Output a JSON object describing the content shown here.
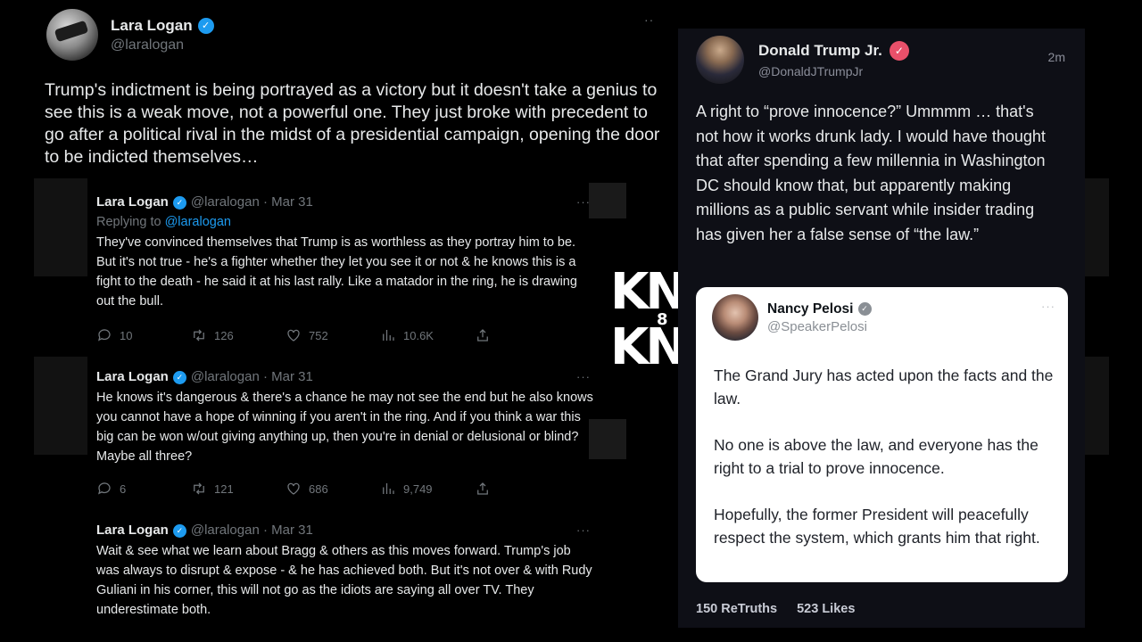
{
  "main_tweet": {
    "name": "Lara Logan",
    "handle": "@laralogan",
    "more": "··",
    "text": "Trump's indictment is being portrayed as a victory but it doesn't take a genius to see this is a weak move, not a powerful one. They just broke with precedent to go after a political rival in the midst of a presidential campaign, opening the door to be indicted themselves…"
  },
  "replies": [
    {
      "name": "Lara Logan",
      "meta": "@laralogan · Mar 31",
      "replying_prefix": "Replying to ",
      "replying_to": "@laralogan",
      "text": "They've convinced themselves that Trump is as worthless as they portray him to be. But it's not true - he's a fighter whether they let you see it or not & he knows this is a fight to the death - he said it at his last rally. Like a matador in the ring, he is drawing out the bull.",
      "replies_count": "10",
      "retweets": "126",
      "likes": "752",
      "views": "10.6K"
    },
    {
      "name": "Lara Logan",
      "meta": "@laralogan · Mar 31",
      "text": "He knows it's dangerous & there's a chance he may not see the end but he also knows you cannot have a hope of winning if you aren't in the ring. And if you think a war this big can be won w/out giving anything up, then you're in denial or delusional or blind? Maybe all three?",
      "replies_count": "6",
      "retweets": "121",
      "likes": "686",
      "views": "9,749"
    },
    {
      "name": "Lara Logan",
      "meta": "@laralogan · Mar 31",
      "text": "Wait & see what we learn about Bragg & others as this moves forward. Trump's job was always to disrupt & expose - & he has achieved both. But it's not over & with Rudy Guliani in his corner, this will not go as the idiots are saying all over TV. They underestimate both."
    }
  ],
  "logo": {
    "top": "KN",
    "middle": "8",
    "bottom": "KN"
  },
  "truth_post": {
    "name": "Donald Trump Jr.",
    "handle": "@DonaldJTrumpJr",
    "time": "2m",
    "text": "A right to “prove innocence?” Ummmm … that's not how it works drunk lady. I would have thought that after spending a few millennia in Washington DC should know that, but apparently making millions as a public servant while insider trading has given her a false sense of “the law.”",
    "quoted": {
      "name": "Nancy Pelosi",
      "handle": "@SpeakerPelosi",
      "more": "···",
      "p1": "The Grand Jury has acted upon the facts and the law.",
      "p2": "No one is above the law, and everyone has the right to a trial to prove innocence.",
      "p3": "Hopefully, the former President will peacefully respect the system, which grants him that right."
    },
    "retruths_count": "150",
    "retruths_label": "ReTruths",
    "likes_count": "523",
    "likes_label": "Likes"
  },
  "icons": {
    "reply": "reply-icon",
    "retweet": "retweet-icon",
    "like": "heart-icon",
    "views": "views-icon",
    "share": "share-icon"
  },
  "colors": {
    "twitter_blue": "#1d9bf0",
    "truth_badge": "#e8506a",
    "panel_bg": "#0e0f16"
  }
}
